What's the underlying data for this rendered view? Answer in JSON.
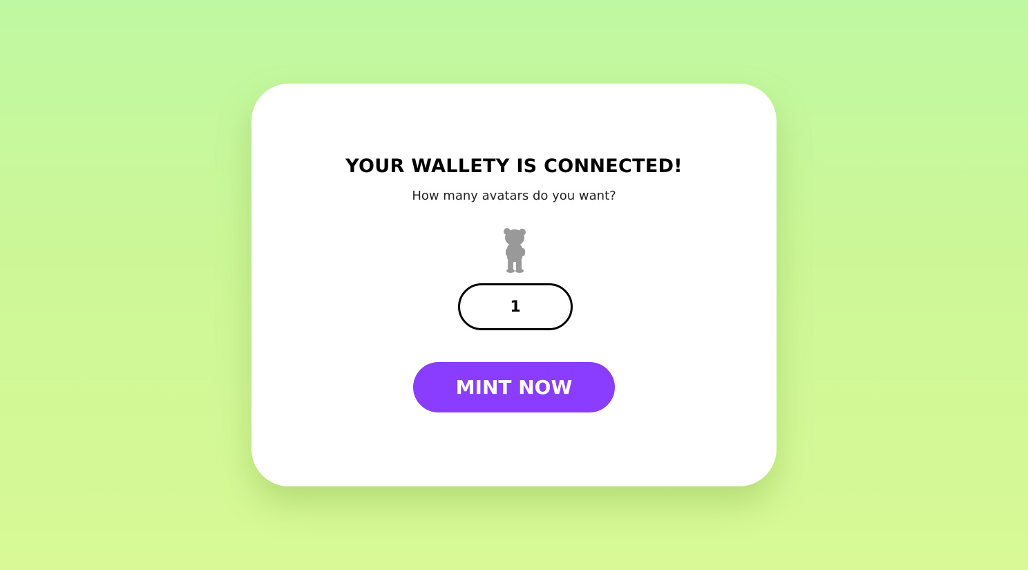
{
  "card": {
    "title": "YOUR WALLETY IS CONNECTED!",
    "subtitle": "How many avatars do you want?",
    "avatar_icon": "bear-avatar-silhouette-icon",
    "quantity_value": "1",
    "mint_label": "MINT NOW"
  },
  "colors": {
    "background_top": "#bff8a2",
    "background_bottom": "#d8f996",
    "card": "#ffffff",
    "accent": "#8a3cff",
    "avatar": "#999999"
  }
}
